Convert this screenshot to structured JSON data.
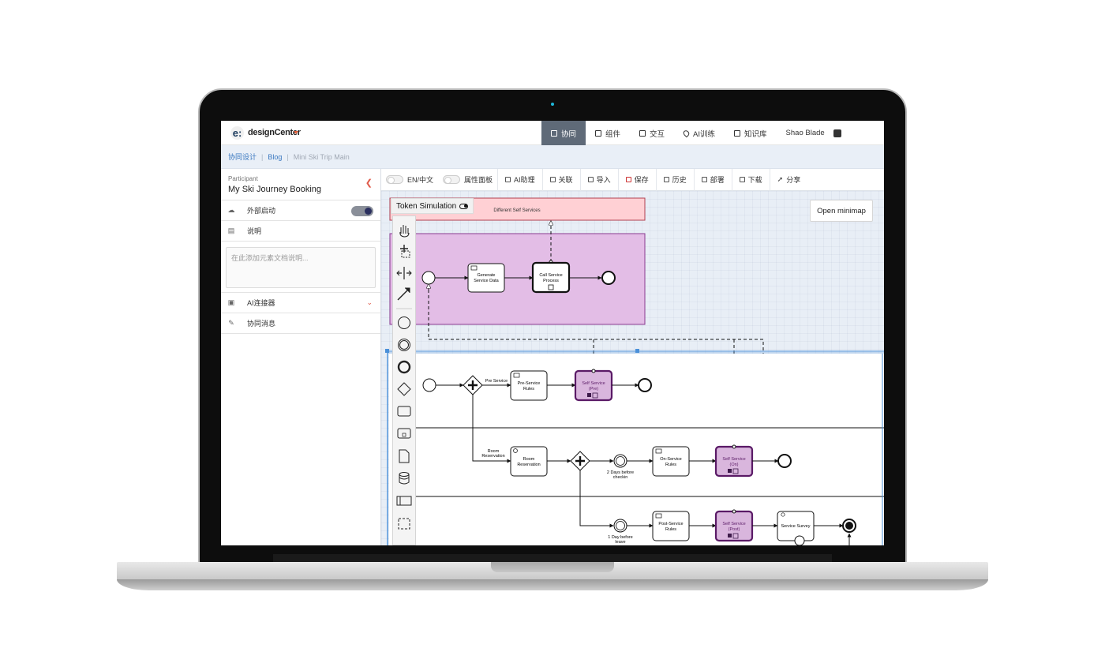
{
  "app": {
    "logo_mark": "e:",
    "logo_text": "designCenter"
  },
  "nav": {
    "items": [
      {
        "label": "协同",
        "active": true,
        "icon": "collab-icon"
      },
      {
        "label": "组件",
        "active": false,
        "icon": "component-icon"
      },
      {
        "label": "交互",
        "active": false,
        "icon": "interaction-icon"
      },
      {
        "label": "AI训练",
        "active": false,
        "icon": "location-pin-icon"
      },
      {
        "label": "知识库",
        "active": false,
        "icon": "book-icon"
      }
    ],
    "user_name": "Shao Blade"
  },
  "breadcrumb": {
    "items": [
      "协同设计",
      "Blog",
      "Mini Ski Trip Main"
    ]
  },
  "left_panel": {
    "type_label": "Participant",
    "name": "My Ski Journey Booking",
    "rows": {
      "external_start": "外部启动",
      "description": "说明",
      "ai_connector": "AI连接器",
      "collab_message": "协同消息"
    },
    "doc_placeholder": "在此添加元素文档说明...",
    "external_start_enabled": true
  },
  "toolbar": {
    "lang_toggle": "EN/中文",
    "props_panel": "属性面板",
    "ai_assistant": "AI助理",
    "link": "关联",
    "import": "导入",
    "save": "保存",
    "history": "历史",
    "deploy": "部署",
    "download": "下载",
    "share": "分享"
  },
  "canvas": {
    "minimap_button": "Open minimap",
    "token_simulation": "Token Simulation",
    "diagram": {
      "pool_top_label": "Different Self Services",
      "tasks": {
        "generate": [
          "Generate",
          "Service Data"
        ],
        "call": [
          "Call Service",
          "Process"
        ],
        "pre_rules": [
          "Pre-Service",
          "Rules"
        ],
        "self_pre": [
          "Self Service",
          "(Pre)"
        ],
        "room_res": [
          "Room",
          "Reservation"
        ],
        "on_rules": [
          "On-Service",
          "Rules"
        ],
        "self_on": [
          "Self Service",
          "(On)"
        ],
        "post_rules": [
          "Post-Service",
          "Rules"
        ],
        "self_post": [
          "Self Service",
          "(Post)"
        ],
        "survey": [
          "Service Survey"
        ]
      },
      "labels": {
        "pre_service": "Pre Service",
        "room_reservation": [
          "Room",
          "Reservation"
        ],
        "two_days": [
          "2 Days before",
          "checkin"
        ],
        "one_day": [
          "1 Day before",
          "leave"
        ]
      }
    }
  },
  "colors": {
    "nav_active": "#5f6a78",
    "accent_link": "#3a78c0",
    "pool_pink": "#ffd0d4",
    "pool_purple": "#e3bde6",
    "subprocess_fill": "#d9b6dd",
    "subprocess_stroke": "#5a1a66"
  }
}
